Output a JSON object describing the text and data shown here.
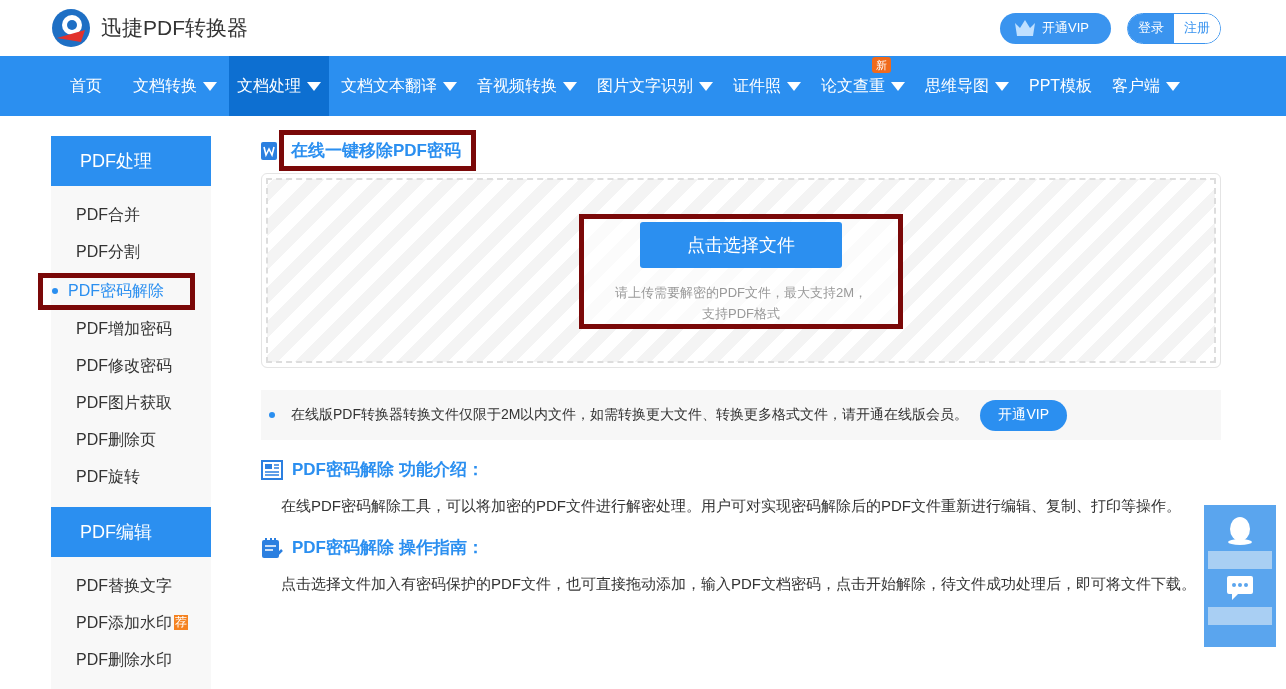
{
  "header": {
    "logo_text": "迅捷PDF转换器",
    "vip_button": "开通VIP",
    "login": "登录",
    "register": "注册"
  },
  "nav": [
    {
      "label": "首页",
      "dropdown": false,
      "selected": false
    },
    {
      "label": "文档转换",
      "dropdown": true,
      "selected": false
    },
    {
      "label": "文档处理",
      "dropdown": true,
      "selected": true
    },
    {
      "label": "文档文本翻译",
      "dropdown": true,
      "selected": false
    },
    {
      "label": "音视频转换",
      "dropdown": true,
      "selected": false
    },
    {
      "label": "图片文字识别",
      "dropdown": true,
      "selected": false
    },
    {
      "label": "证件照",
      "dropdown": true,
      "selected": false
    },
    {
      "label": "论文查重",
      "dropdown": true,
      "selected": false,
      "badge": "新"
    },
    {
      "label": "思维导图",
      "dropdown": true,
      "selected": false
    },
    {
      "label": "PPT模板",
      "dropdown": false,
      "selected": false
    },
    {
      "label": "客户端",
      "dropdown": true,
      "selected": false
    }
  ],
  "sidebar": [
    {
      "title": "PDF处理",
      "items": [
        {
          "label": "PDF合并",
          "selected": false
        },
        {
          "label": "PDF分割",
          "selected": false
        },
        {
          "label": "PDF密码解除",
          "selected": true
        },
        {
          "label": "PDF增加密码",
          "selected": false
        },
        {
          "label": "PDF修改密码",
          "selected": false
        },
        {
          "label": "PDF图片获取",
          "selected": false
        },
        {
          "label": "PDF删除页",
          "selected": false
        },
        {
          "label": "PDF旋转",
          "selected": false
        }
      ]
    },
    {
      "title": "PDF编辑",
      "items": [
        {
          "label": "PDF替换文字",
          "selected": false
        },
        {
          "label": "PDF添加水印",
          "selected": false,
          "tag": "荐"
        },
        {
          "label": "PDF删除水印",
          "selected": false
        }
      ]
    }
  ],
  "main": {
    "title": "在线一键移除PDF密码",
    "upload_button": "点击选择文件",
    "upload_hint": [
      "请上传需要解密的PDF文件，最大支持2M，",
      "支持PDF格式"
    ],
    "notice": "在线版PDF转换器转换文件仅限于2M以内文件，如需转换更大文件、转换更多格式文件，请开通在线版会员。",
    "notice_button": "开通VIP",
    "sections": [
      {
        "kind": "intro",
        "title": "PDF密码解除 功能介绍：",
        "text": "在线PDF密码解除工具，可以将加密的PDF文件进行解密处理。用户可对实现密码解除后的PDF文件重新进行编辑、复制、打印等操作。"
      },
      {
        "kind": "guide",
        "title": "PDF密码解除 操作指南：",
        "text": "点击选择文件加入有密码保护的PDF文件，也可直接拖动添加，输入PDF文档密码，点击开始解除，待文件成功处理后，即可将文件下载。"
      }
    ]
  }
}
